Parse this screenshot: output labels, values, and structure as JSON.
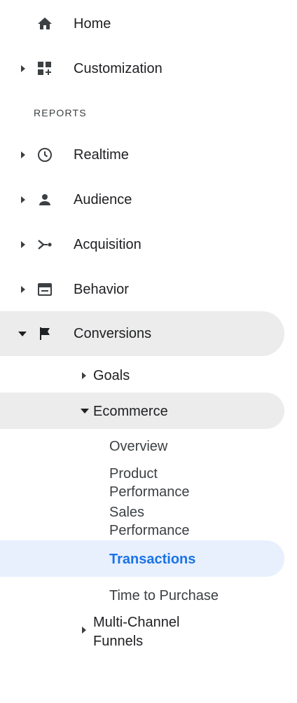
{
  "nav": {
    "home": {
      "label": "Home",
      "icon": "home-icon"
    },
    "customization": {
      "label": "Customization",
      "icon": "dashboard-icon"
    },
    "reports_header": "REPORTS",
    "realtime": {
      "label": "Realtime",
      "icon": "clock-icon"
    },
    "audience": {
      "label": "Audience",
      "icon": "person-icon"
    },
    "acquisition": {
      "label": "Acquisition",
      "icon": "acquisition-icon"
    },
    "behavior": {
      "label": "Behavior",
      "icon": "behavior-icon"
    },
    "conversions": {
      "label": "Conversions",
      "icon": "flag-icon",
      "goals": "Goals",
      "ecommerce": {
        "label": "Ecommerce",
        "items": {
          "overview": "Overview",
          "product_performance_1": "Product",
          "product_performance_2": "Performance",
          "sales_performance_1": "Sales",
          "sales_performance_2": "Performance",
          "transactions": "Transactions",
          "time_to_purchase": "Time to Purchase"
        }
      },
      "multi_channel_1": "Multi-Channel",
      "multi_channel_2": "Funnels"
    }
  },
  "colors": {
    "active_text": "#1a73e8",
    "active_bg": "#e8f0fe",
    "expanded_bg": "#ececec",
    "icon": "#3c4043"
  }
}
